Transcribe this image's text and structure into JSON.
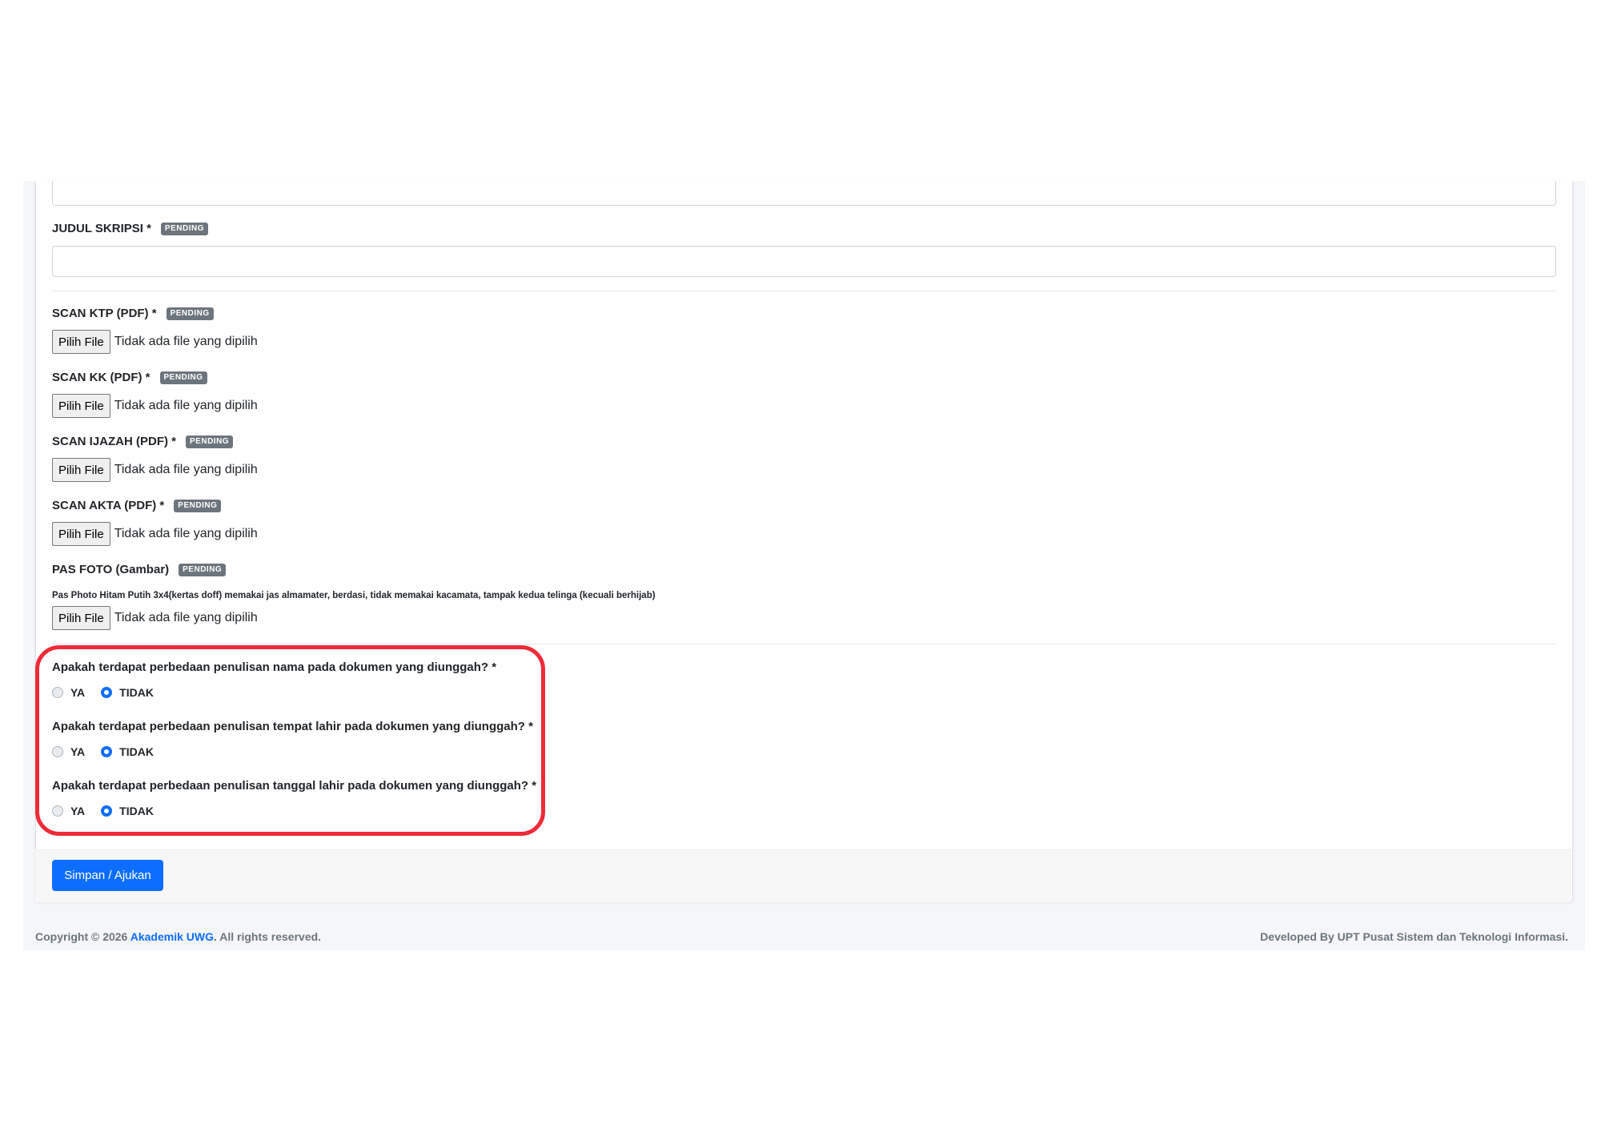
{
  "form": {
    "judul_label": "JUDUL SKRIPSI *",
    "badge": "PENDING",
    "judul_value": "",
    "uploads": [
      {
        "label": "SCAN KTP (PDF) *",
        "badge": "PENDING",
        "button": "Pilih File",
        "status": "Tidak ada file yang dipilih"
      },
      {
        "label": "SCAN KK (PDF) *",
        "badge": "PENDING",
        "button": "Pilih File",
        "status": "Tidak ada file yang dipilih"
      },
      {
        "label": "SCAN IJAZAH (PDF) *",
        "badge": "PENDING",
        "button": "Pilih File",
        "status": "Tidak ada file yang dipilih"
      },
      {
        "label": "SCAN AKTA (PDF) *",
        "badge": "PENDING",
        "button": "Pilih File",
        "status": "Tidak ada file yang dipilih"
      },
      {
        "label": "PAS FOTO (Gambar)",
        "badge": "PENDING",
        "button": "Pilih File",
        "status": "Tidak ada file yang dipilih",
        "hint": "Pas Photo Hitam Putih 3x4(kertas doff) memakai jas almamater, berdasi, tidak memakai kacamata, tampak kedua telinga (kecuali berhijab)"
      }
    ],
    "questions": [
      {
        "text": "Apakah terdapat perbedaan penulisan nama pada dokumen yang diunggah? *",
        "option_yes": "YA",
        "option_no": "TIDAK",
        "selected": "TIDAK"
      },
      {
        "text": "Apakah terdapat perbedaan penulisan tempat lahir pada dokumen yang diunggah? *",
        "option_yes": "YA",
        "option_no": "TIDAK",
        "selected": "TIDAK"
      },
      {
        "text": "Apakah terdapat perbedaan penulisan tanggal lahir pada dokumen yang diunggah? *",
        "option_yes": "YA",
        "option_no": "TIDAK",
        "selected": "TIDAK"
      }
    ],
    "submit_label": "Simpan / Ajukan"
  },
  "footer": {
    "copyright_prefix": "Copyright © 2026 ",
    "copyright_link": "Akademik UWG",
    "copyright_suffix": ". All rights reserved.",
    "developed": "Developed By UPT Pusat Sistem dan Teknologi Informasi."
  },
  "colors": {
    "primary": "#0d6efd",
    "badge": "#6c757d",
    "highlight": "#ee2b38"
  }
}
